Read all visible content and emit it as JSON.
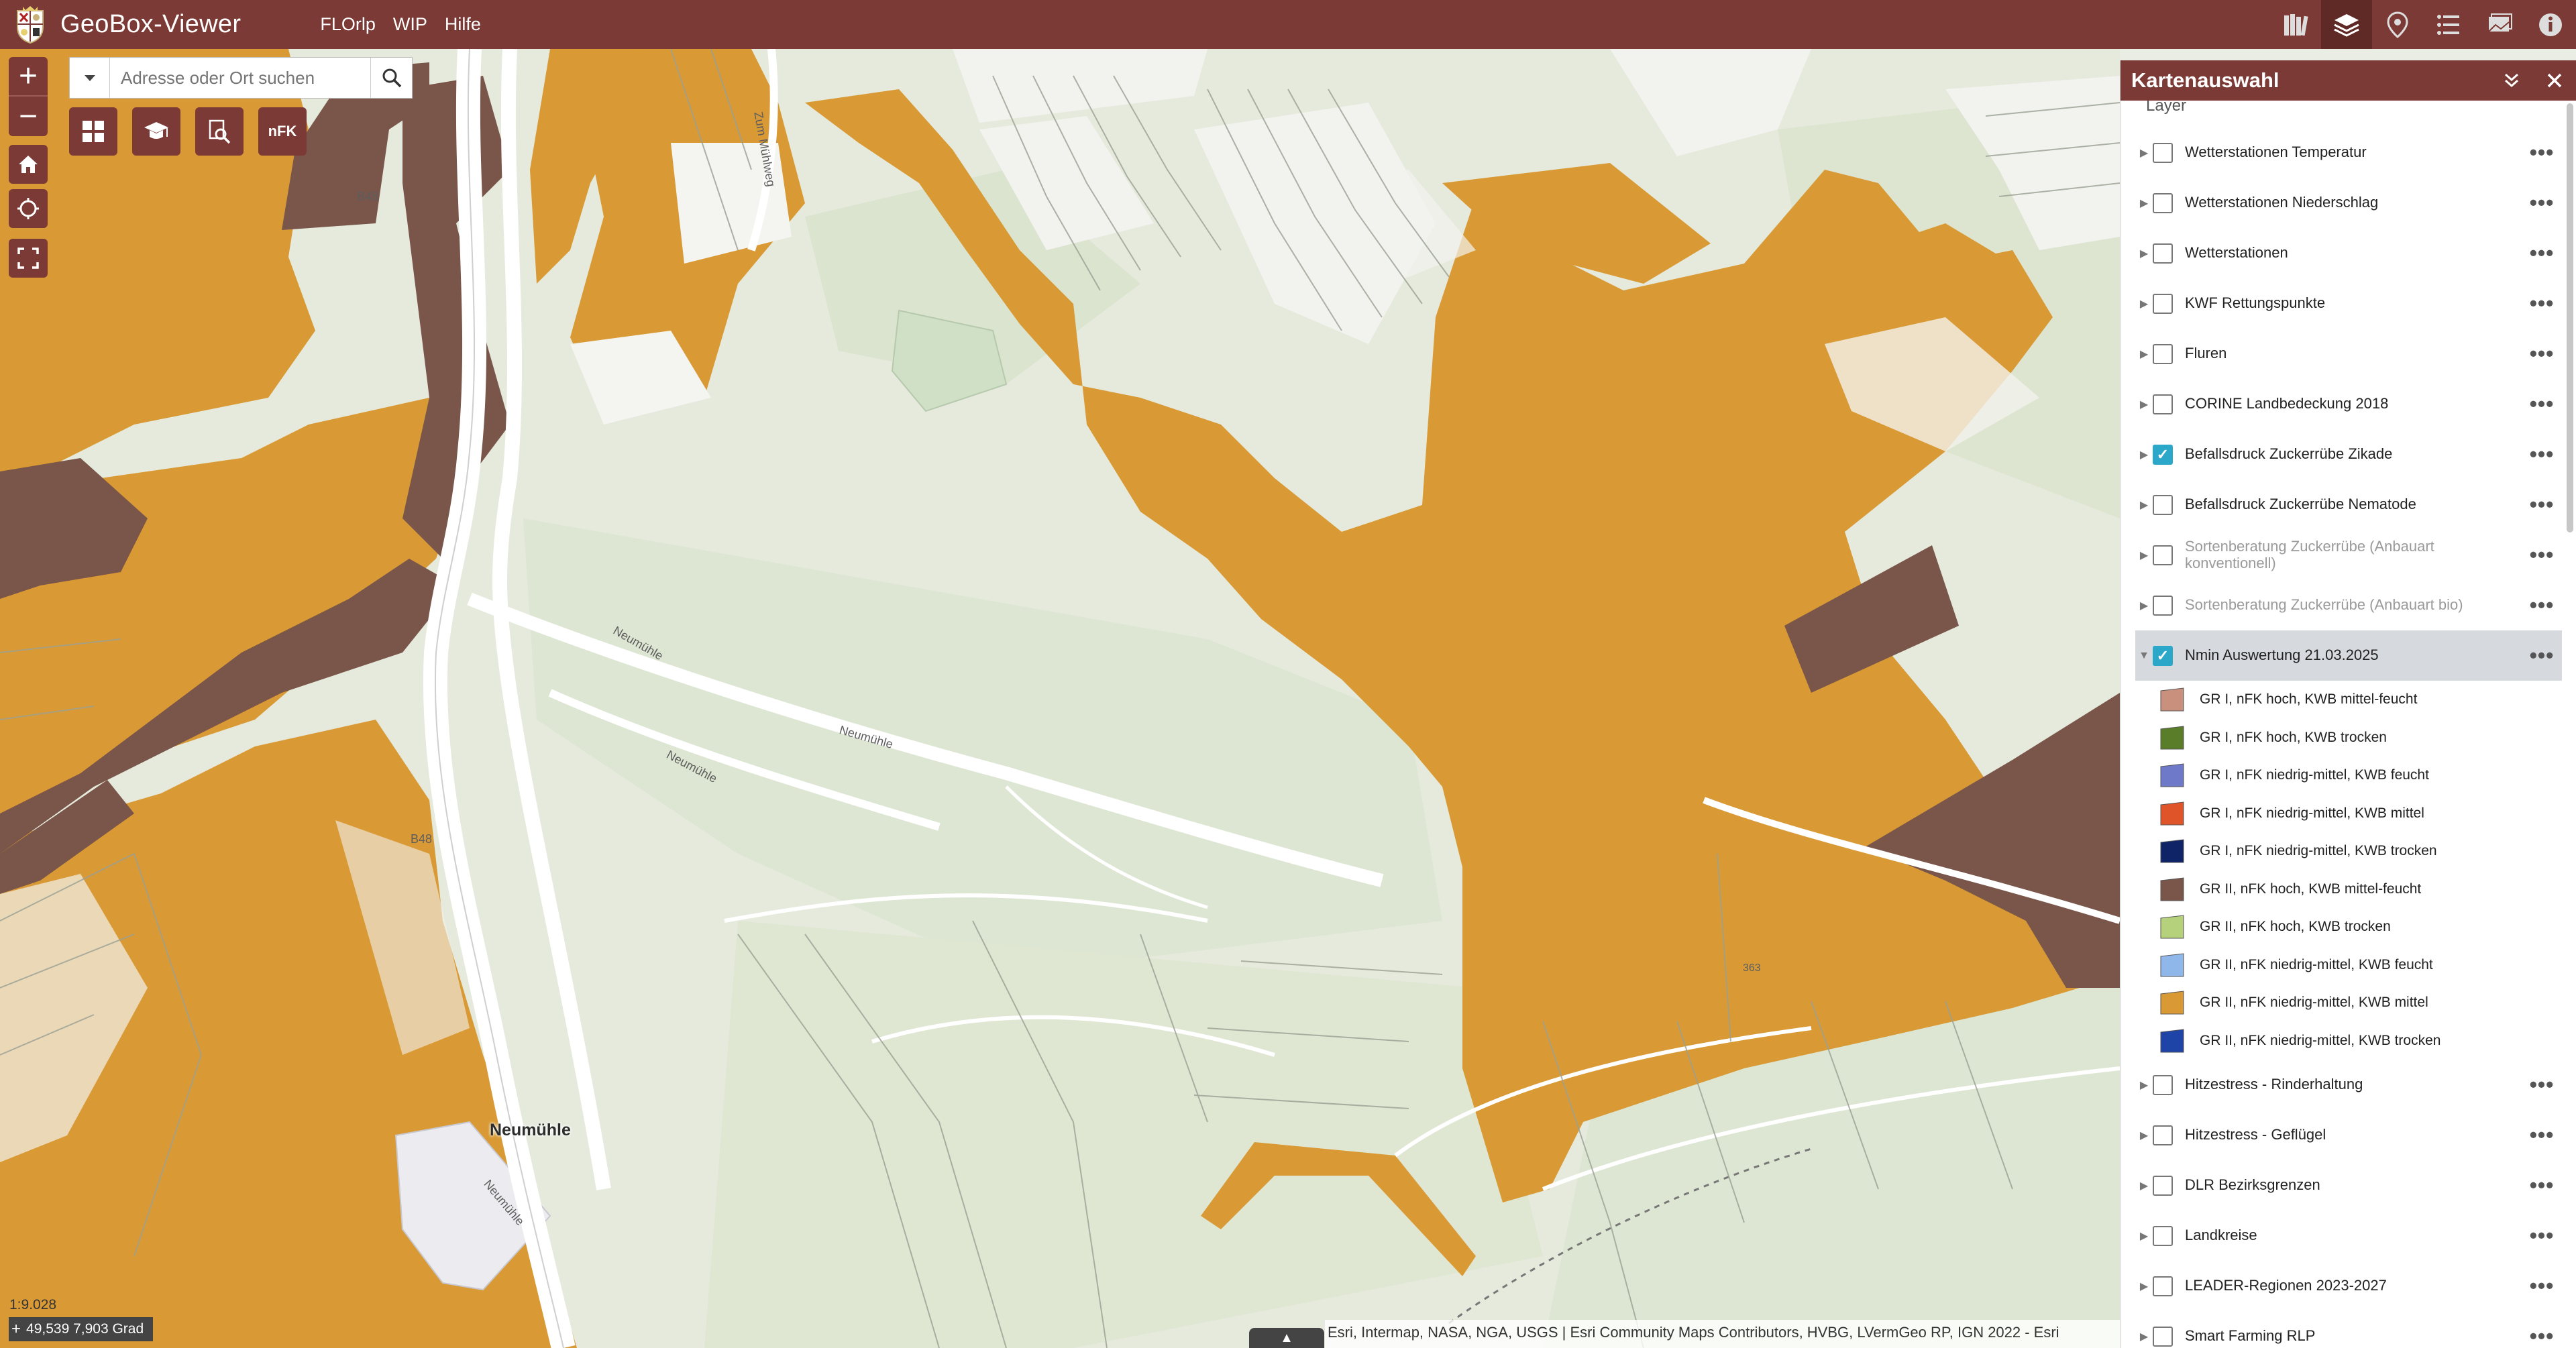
{
  "app": {
    "title": "GeoBox-Viewer",
    "nav": [
      "FLOrlp",
      "WIP",
      "Hilfe"
    ]
  },
  "header_icons": [
    {
      "name": "library-icon",
      "active": false
    },
    {
      "name": "layers-icon",
      "active": true
    },
    {
      "name": "location-pin-icon",
      "active": false
    },
    {
      "name": "list-icon",
      "active": false
    },
    {
      "name": "basemap-icon",
      "active": false
    },
    {
      "name": "info-icon",
      "active": false
    }
  ],
  "search": {
    "placeholder": "Adresse oder Ort suchen"
  },
  "tools": {
    "nfk_label": "nFK"
  },
  "map": {
    "scale": "1:9.028",
    "coords": "49,539 7,903 Grad",
    "attribution": "Esri, Intermap, NASA, NGA, USGS | Esri Community Maps Contributors, HVBG, LVermGeo RP, IGN 2022 - Esri",
    "labels": {
      "place": "Neumühle",
      "street1": "Neumühle",
      "street2": "Neumühle",
      "street3": "Neumühle",
      "street4": "Neumühle",
      "road1": "B48",
      "road2": "B48",
      "road3": "Zum Mühlweg",
      "elev": "363"
    },
    "colors": {
      "orange": "#d99a36",
      "brown": "#7a5549",
      "land": "#e5eadc",
      "road": "#ffffff"
    }
  },
  "panel": {
    "title": "Kartenauswahl",
    "subtitle": "Layer",
    "layers": [
      {
        "label": "Wetterstationen Temperatur",
        "checked": false,
        "muted": false
      },
      {
        "label": "Wetterstationen Niederschlag",
        "checked": false,
        "muted": false
      },
      {
        "label": "Wetterstationen",
        "checked": false,
        "muted": false
      },
      {
        "label": "KWF Rettungspunkte",
        "checked": false,
        "muted": false
      },
      {
        "label": "Fluren",
        "checked": false,
        "muted": false
      },
      {
        "label": "CORINE Landbedeckung 2018",
        "checked": false,
        "muted": false
      },
      {
        "label": "Befallsdruck Zuckerrübe Zikade",
        "checked": true,
        "muted": false
      },
      {
        "label": "Befallsdruck Zuckerrübe Nematode",
        "checked": false,
        "muted": false
      },
      {
        "label": "Sortenberatung Zuckerrübe (Anbauart konventionell)",
        "checked": false,
        "muted": true
      },
      {
        "label": "Sortenberatung Zuckerrübe (Anbauart bio)",
        "checked": false,
        "muted": true
      },
      {
        "label": "Nmin Auswertung 21.03.2025",
        "checked": true,
        "muted": false,
        "selected": true,
        "expanded": true
      }
    ],
    "legend": [
      {
        "label": "GR I, nFK hoch, KWB mittel-feucht",
        "color": "#c9917d"
      },
      {
        "label": "GR I, nFK hoch, KWB trocken",
        "color": "#5a7d2a"
      },
      {
        "label": "GR I, nFK niedrig-mittel, KWB feucht",
        "color": "#6f79c9"
      },
      {
        "label": "GR I, nFK niedrig-mittel, KWB mittel",
        "color": "#e0542a"
      },
      {
        "label": "GR I, nFK niedrig-mittel, KWB trocken",
        "color": "#0f2466"
      },
      {
        "label": "GR II, nFK hoch, KWB mittel-feucht",
        "color": "#7a5549"
      },
      {
        "label": "GR II, nFK hoch, KWB trocken",
        "color": "#b6d17c"
      },
      {
        "label": "GR II, nFK niedrig-mittel, KWB feucht",
        "color": "#8fb7ea"
      },
      {
        "label": "GR II, nFK niedrig-mittel, KWB mittel",
        "color": "#d99a36"
      },
      {
        "label": "GR II, nFK niedrig-mittel, KWB trocken",
        "color": "#1f44a8"
      }
    ],
    "layers_after": [
      {
        "label": "Hitzestress - Rinderhaltung",
        "checked": false
      },
      {
        "label": "Hitzestress - Geflügel",
        "checked": false
      },
      {
        "label": "DLR Bezirksgrenzen",
        "checked": false
      },
      {
        "label": "Landkreise",
        "checked": false
      },
      {
        "label": "LEADER-Regionen 2023-2027",
        "checked": false
      },
      {
        "label": "Smart Farming RLP",
        "checked": false
      }
    ]
  }
}
